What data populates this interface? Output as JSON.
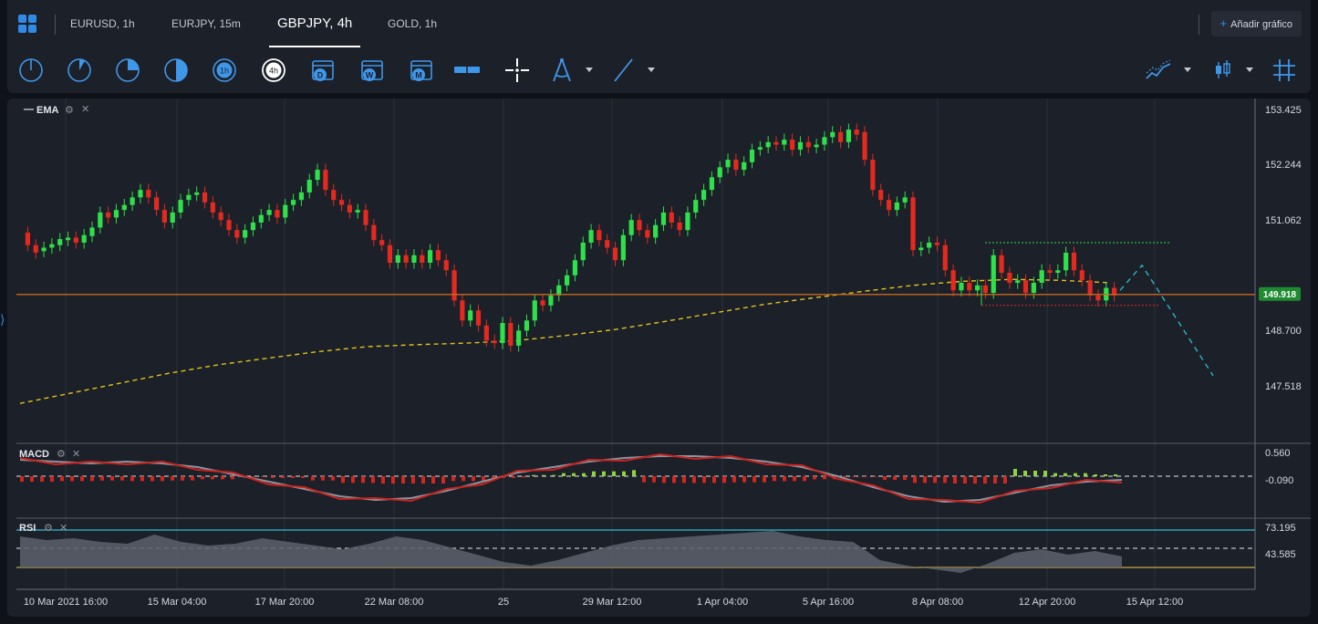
{
  "tabs": [
    {
      "label": "EURUSD, 1h"
    },
    {
      "label": "EURJPY, 15m"
    },
    {
      "label": "GBPJPY, 4h"
    },
    {
      "label": "GOLD, 1h"
    }
  ],
  "add_chart_label": "Añadir gráfico",
  "toolbar": {
    "timeframes": [
      {
        "name": "1m"
      },
      {
        "name": "5m"
      },
      {
        "name": "15m"
      },
      {
        "name": "30m"
      },
      {
        "name": "1h",
        "text": "1h"
      },
      {
        "name": "4h",
        "text": "4h"
      },
      {
        "name": "day",
        "text": "D"
      },
      {
        "name": "week",
        "text": "W"
      },
      {
        "name": "month",
        "text": "M"
      }
    ]
  },
  "indicators": {
    "ema": "EMA",
    "macd": "MACD",
    "rsi": "RSI"
  },
  "chart_data": {
    "type": "candlestick",
    "symbol": "GBPJPY",
    "timeframe": "4h",
    "price_axis": [
      "153.425",
      "152.244",
      "151.062",
      "149.918",
      "148.700",
      "147.518"
    ],
    "current_price": "149.918",
    "macd_axis": [
      "0.560",
      "-0.090"
    ],
    "rsi_axis": [
      "73.195",
      "43.585"
    ],
    "time_axis": [
      "10 Mar 2021 16:00",
      "15 Mar 04:00",
      "17 Mar 20:00",
      "22 Mar 08:00",
      "25",
      "29 Mar 12:00",
      "1 Apr 04:00",
      "5 Apr 16:00",
      "8 Apr 08:00",
      "12 Apr 20:00",
      "15 Apr 12:00"
    ],
    "ylim": [
      147.1,
      153.6
    ],
    "candles": [
      {
        "o": 151.15,
        "c": 150.9
      },
      {
        "o": 150.9,
        "c": 150.75
      },
      {
        "o": 150.78,
        "c": 150.85
      },
      {
        "o": 150.85,
        "c": 150.92
      },
      {
        "o": 150.9,
        "c": 151.02
      },
      {
        "o": 151.0,
        "c": 151.05
      },
      {
        "o": 151.05,
        "c": 150.95
      },
      {
        "o": 150.95,
        "c": 151.1
      },
      {
        "o": 151.08,
        "c": 151.25
      },
      {
        "o": 151.25,
        "c": 151.55
      },
      {
        "o": 151.55,
        "c": 151.45
      },
      {
        "o": 151.45,
        "c": 151.6
      },
      {
        "o": 151.6,
        "c": 151.7
      },
      {
        "o": 151.7,
        "c": 151.85
      },
      {
        "o": 151.85,
        "c": 152.0
      },
      {
        "o": 152.0,
        "c": 151.85
      },
      {
        "o": 151.85,
        "c": 151.6
      },
      {
        "o": 151.6,
        "c": 151.35
      },
      {
        "o": 151.35,
        "c": 151.55
      },
      {
        "o": 151.55,
        "c": 151.8
      },
      {
        "o": 151.8,
        "c": 151.9
      },
      {
        "o": 151.9,
        "c": 151.95
      },
      {
        "o": 151.95,
        "c": 151.75
      },
      {
        "o": 151.75,
        "c": 151.55
      },
      {
        "o": 151.55,
        "c": 151.4
      },
      {
        "o": 151.4,
        "c": 151.2
      },
      {
        "o": 151.2,
        "c": 151.05
      },
      {
        "o": 151.05,
        "c": 151.2
      },
      {
        "o": 151.2,
        "c": 151.35
      },
      {
        "o": 151.35,
        "c": 151.5
      },
      {
        "o": 151.5,
        "c": 151.6
      },
      {
        "o": 151.6,
        "c": 151.45
      },
      {
        "o": 151.45,
        "c": 151.7
      },
      {
        "o": 151.7,
        "c": 151.8
      },
      {
        "o": 151.8,
        "c": 151.95
      },
      {
        "o": 151.95,
        "c": 152.2
      },
      {
        "o": 152.2,
        "c": 152.4
      },
      {
        "o": 152.4,
        "c": 152.0
      },
      {
        "o": 152.0,
        "c": 151.8
      },
      {
        "o": 151.8,
        "c": 151.7
      },
      {
        "o": 151.7,
        "c": 151.55
      },
      {
        "o": 151.55,
        "c": 151.6
      },
      {
        "o": 151.6,
        "c": 151.3
      },
      {
        "o": 151.3,
        "c": 151.0
      },
      {
        "o": 151.0,
        "c": 150.9
      },
      {
        "o": 150.9,
        "c": 150.55
      },
      {
        "o": 150.55,
        "c": 150.7
      },
      {
        "o": 150.7,
        "c": 150.55
      },
      {
        "o": 150.55,
        "c": 150.7
      },
      {
        "o": 150.7,
        "c": 150.55
      },
      {
        "o": 150.55,
        "c": 150.8
      },
      {
        "o": 150.8,
        "c": 150.6
      },
      {
        "o": 150.6,
        "c": 150.4
      },
      {
        "o": 150.4,
        "c": 149.8
      },
      {
        "o": 149.8,
        "c": 149.4
      },
      {
        "o": 149.4,
        "c": 149.6
      },
      {
        "o": 149.6,
        "c": 149.3
      },
      {
        "o": 149.3,
        "c": 149.0
      },
      {
        "o": 149.0,
        "c": 148.95
      },
      {
        "o": 148.95,
        "c": 149.35
      },
      {
        "o": 149.35,
        "c": 148.9
      },
      {
        "o": 148.9,
        "c": 149.2
      },
      {
        "o": 149.2,
        "c": 149.4
      },
      {
        "o": 149.4,
        "c": 149.8
      },
      {
        "o": 149.8,
        "c": 149.7
      },
      {
        "o": 149.7,
        "c": 149.9
      },
      {
        "o": 149.9,
        "c": 150.1
      },
      {
        "o": 150.1,
        "c": 150.3
      },
      {
        "o": 150.3,
        "c": 150.6
      },
      {
        "o": 150.6,
        "c": 150.95
      },
      {
        "o": 150.95,
        "c": 151.2
      },
      {
        "o": 151.2,
        "c": 151.0
      },
      {
        "o": 151.0,
        "c": 150.85
      },
      {
        "o": 150.85,
        "c": 150.6
      },
      {
        "o": 150.6,
        "c": 151.1
      },
      {
        "o": 151.1,
        "c": 151.4
      },
      {
        "o": 151.4,
        "c": 151.2
      },
      {
        "o": 151.2,
        "c": 151.05
      },
      {
        "o": 151.05,
        "c": 151.3
      },
      {
        "o": 151.3,
        "c": 151.55
      },
      {
        "o": 151.55,
        "c": 151.35
      },
      {
        "o": 151.35,
        "c": 151.2
      },
      {
        "o": 151.2,
        "c": 151.55
      },
      {
        "o": 151.55,
        "c": 151.8
      },
      {
        "o": 151.8,
        "c": 152.0
      },
      {
        "o": 152.0,
        "c": 152.25
      },
      {
        "o": 152.25,
        "c": 152.45
      },
      {
        "o": 152.45,
        "c": 152.6
      },
      {
        "o": 152.6,
        "c": 152.4
      },
      {
        "o": 152.4,
        "c": 152.55
      },
      {
        "o": 152.55,
        "c": 152.8
      },
      {
        "o": 152.8,
        "c": 152.85
      },
      {
        "o": 152.85,
        "c": 152.95
      },
      {
        "o": 152.95,
        "c": 152.9
      },
      {
        "o": 152.9,
        "c": 153.0
      },
      {
        "o": 153.0,
        "c": 152.8
      },
      {
        "o": 152.8,
        "c": 152.95
      },
      {
        "o": 152.95,
        "c": 152.85
      },
      {
        "o": 152.85,
        "c": 152.9
      },
      {
        "o": 152.9,
        "c": 153.05
      },
      {
        "o": 153.05,
        "c": 153.15
      },
      {
        "o": 153.15,
        "c": 152.95
      },
      {
        "o": 152.95,
        "c": 153.2
      },
      {
        "o": 153.2,
        "c": 153.1
      },
      {
        "o": 153.15,
        "c": 152.6
      },
      {
        "o": 152.6,
        "c": 152.0
      },
      {
        "o": 152.0,
        "c": 151.8
      },
      {
        "o": 151.8,
        "c": 151.6
      },
      {
        "o": 151.6,
        "c": 151.75
      },
      {
        "o": 151.75,
        "c": 151.85
      },
      {
        "o": 151.85,
        "c": 150.8
      },
      {
        "o": 150.8,
        "c": 150.85
      },
      {
        "o": 150.85,
        "c": 150.95
      },
      {
        "o": 150.95,
        "c": 150.9
      },
      {
        "o": 150.9,
        "c": 150.4
      },
      {
        "o": 150.4,
        "c": 150.0
      },
      {
        "o": 150.0,
        "c": 150.15
      },
      {
        "o": 150.15,
        "c": 150.0
      },
      {
        "o": 150.0,
        "c": 150.1
      },
      {
        "o": 150.1,
        "c": 149.95
      },
      {
        "o": 149.95,
        "c": 150.7
      },
      {
        "o": 150.7,
        "c": 150.35
      },
      {
        "o": 150.35,
        "c": 150.15
      },
      {
        "o": 150.15,
        "c": 150.2
      },
      {
        "o": 150.2,
        "c": 149.95
      },
      {
        "o": 149.95,
        "c": 150.15
      },
      {
        "o": 150.15,
        "c": 150.4
      },
      {
        "o": 150.4,
        "c": 150.35
      },
      {
        "o": 150.35,
        "c": 150.4
      },
      {
        "o": 150.4,
        "c": 150.75
      },
      {
        "o": 150.75,
        "c": 150.4
      },
      {
        "o": 150.4,
        "c": 150.2
      },
      {
        "o": 150.2,
        "c": 149.9
      },
      {
        "o": 149.9,
        "c": 149.8
      },
      {
        "o": 149.8,
        "c": 150.05
      },
      {
        "o": 150.05,
        "c": 149.9
      }
    ],
    "ema_curve_y": [
      147.75,
      147.95,
      148.15,
      148.35,
      148.52,
      148.65,
      148.78,
      148.88,
      148.92,
      148.95,
      149.0,
      149.1,
      149.22,
      149.38,
      149.55,
      149.72,
      149.85,
      149.98,
      150.1,
      150.18,
      150.22,
      150.2,
      150.15
    ],
    "support_line": 149.918,
    "resistance_dotted": 150.95,
    "low_dotted": 149.7,
    "forecast": [
      [
        150.0,
        150.5
      ],
      [
        149.8,
        148.3
      ]
    ]
  },
  "colors": {
    "bull": "#2ee04a",
    "bear": "#e4291f",
    "ema": "#e2c21c",
    "support": "#c86a1f",
    "forecast": "#27b5c9",
    "accent": "#2f8be6"
  }
}
